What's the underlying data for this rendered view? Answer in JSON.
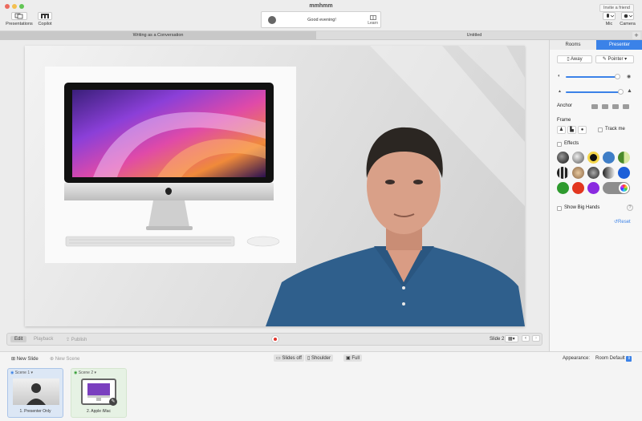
{
  "window": {
    "title": "mmhmm"
  },
  "toolbar": {
    "presentations": "Presentations",
    "copilot": "Copilot",
    "greeting": "Good evening!",
    "learn": "Learn",
    "invite": "Invite a friend",
    "mic": "Mic",
    "camera": "Camera"
  },
  "tabs": [
    {
      "label": "Writing as a Conversation",
      "active": true
    },
    {
      "label": "Untitled",
      "active": false
    }
  ],
  "editbar": {
    "edit": "Edit",
    "playback": "Playback",
    "publish": "Publish",
    "slide_indicator": "Slide 2"
  },
  "panel": {
    "tab_rooms": "Rooms",
    "tab_presenter": "Presenter",
    "away": "Away",
    "pointer": "Pointer",
    "anchor": "Anchor",
    "frame": "Frame",
    "track_me": "Track me",
    "effects": "Effects",
    "show_big_hands": "Show Big Hands",
    "reset": "Reset",
    "opacity_level": 0.92,
    "size_level": 0.96,
    "colors": {
      "accent": "#3b82e8",
      "record": "#e0342c"
    }
  },
  "bottom": {
    "new_slide": "New Slide",
    "new_scene": "New Scene",
    "slides_off": "Slides off",
    "shoulder": "Shoulder",
    "full": "Full",
    "appearance_label": "Appearance:",
    "appearance_value": "Room Default",
    "scenes": [
      {
        "tag": "Scene 1",
        "caption": "1. Presenter Only"
      },
      {
        "tag": "Scene 2",
        "caption": "2. Apple iMac"
      }
    ]
  }
}
